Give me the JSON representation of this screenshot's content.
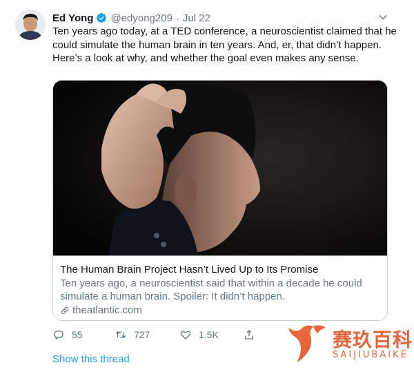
{
  "tweet": {
    "author_name": "Ed Yong",
    "handle": "@edyong209",
    "separator": "·",
    "date": "Jul 22",
    "text": "Ten years ago today, at a TED conference, a neuroscientist claimed that he could simulate the human brain in ten years. And, er, that didn’t happen. Here’s a look at why, and whether the goal even makes any sense."
  },
  "card": {
    "title": "The Human Brain Project Hasn’t Lived Up to Its Promise",
    "description": "Ten years ago, a neuroscientist said that within a decade he could simulate a human brain. Spoiler: It didn’t happen.",
    "domain": "theatlantic.com"
  },
  "actions": {
    "replies": "55",
    "retweets": "727",
    "likes": "1.5K"
  },
  "show_thread": "Show this thread",
  "watermark": {
    "chinese": "赛玖百科",
    "english": "SAIJIUBAIKE"
  },
  "colors": {
    "accent": "#1da1f2",
    "muted": "#657786",
    "text": "#14171a",
    "border": "#ccd6dd",
    "watermark": "#e8643a"
  },
  "icons": [
    "verified-badge-icon",
    "chevron-down-icon",
    "link-icon",
    "reply-icon",
    "retweet-icon",
    "like-icon",
    "share-icon",
    "watermark-logo-icon"
  ]
}
